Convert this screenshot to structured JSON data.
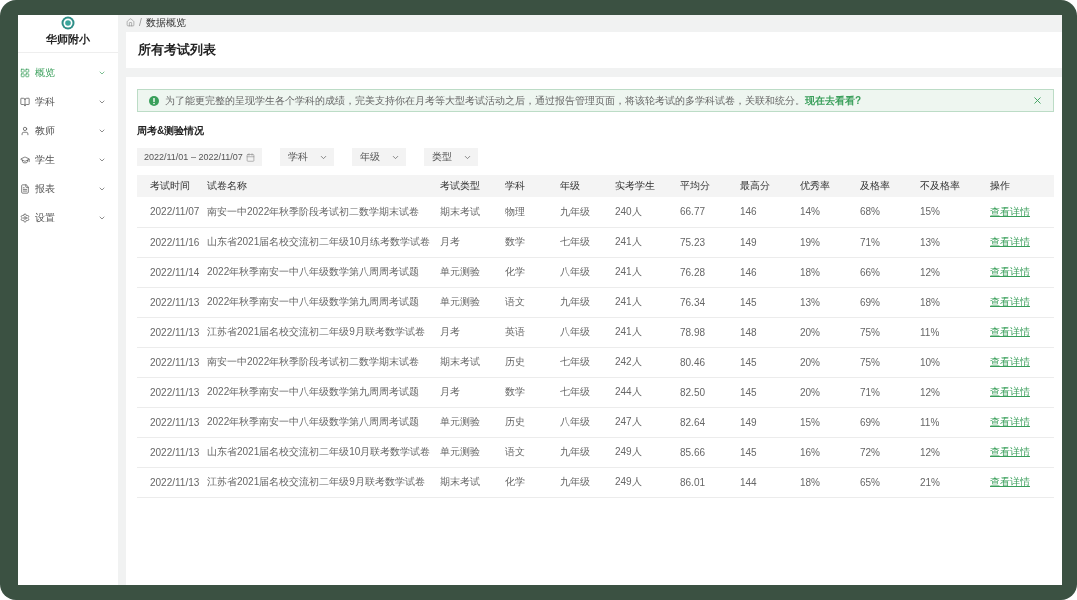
{
  "sidebar": {
    "school_name": "华师附小",
    "items": [
      {
        "label": "概览",
        "selected": true
      },
      {
        "label": "学科",
        "selected": false
      },
      {
        "label": "教师",
        "selected": false
      },
      {
        "label": "学生",
        "selected": false
      },
      {
        "label": "报表",
        "selected": false
      },
      {
        "label": "设置",
        "selected": false
      }
    ]
  },
  "breadcrumb": {
    "separator": "/",
    "label": "数据概览"
  },
  "page_title": "所有考试列表",
  "alert": {
    "message": "为了能更完整的呈现学生各个学科的成绩，完美支持你在月考等大型考试活动之后，通过报告管理页面，将该轮考试的多学科试卷，关联和统分。",
    "link": "现在去看看?"
  },
  "section_title": "周考&测验情况",
  "filters": {
    "date_range": "2022/11/01 – 2022/11/07",
    "selects": [
      {
        "label": "学科"
      },
      {
        "label": "年级"
      },
      {
        "label": "类型"
      }
    ]
  },
  "table": {
    "columns": [
      "考试时间",
      "试卷名称",
      "考试类型",
      "学科",
      "年级",
      "实考学生",
      "平均分",
      "最高分",
      "优秀率",
      "及格率",
      "不及格率",
      "操作"
    ],
    "rows": [
      {
        "cells": [
          "2022/11/07",
          "南安一中2022年秋季阶段考试初二数学期末试卷",
          "期末考试",
          "物理",
          "九年级",
          "240人",
          "66.77",
          "146",
          "14%",
          "68%",
          "15%"
        ],
        "action": "查看详情"
      },
      {
        "cells": [
          "2022/11/16",
          "山东省2021届名校交流初二年级10月练考数学试卷",
          "月考",
          "数学",
          "七年级",
          "241人",
          "75.23",
          "149",
          "19%",
          "71%",
          "13%"
        ],
        "action": "查看详情"
      },
      {
        "cells": [
          "2022/11/14",
          "2022年秋季南安一中八年级数学第八周周考试题",
          "单元测验",
          "化学",
          "八年级",
          "241人",
          "76.28",
          "146",
          "18%",
          "66%",
          "12%"
        ],
        "action": "查看详情"
      },
      {
        "cells": [
          "2022/11/13",
          "2022年秋季南安一中八年级数学第九周周考试题",
          "单元测验",
          "语文",
          "九年级",
          "241人",
          "76.34",
          "145",
          "13%",
          "69%",
          "18%"
        ],
        "action": "查看详情"
      },
      {
        "cells": [
          "2022/11/13",
          "江苏省2021届名校交流初二年级9月联考数学试卷",
          "月考",
          "英语",
          "八年级",
          "241人",
          "78.98",
          "148",
          "20%",
          "75%",
          "11%"
        ],
        "action": "查看详情"
      },
      {
        "cells": [
          "2022/11/13",
          "南安一中2022年秋季阶段考试初二数学期末试卷",
          "期末考试",
          "历史",
          "七年级",
          "242人",
          "80.46",
          "145",
          "20%",
          "75%",
          "10%"
        ],
        "action": "查看详情"
      },
      {
        "cells": [
          "2022/11/13",
          "2022年秋季南安一中八年级数学第九周周考试题",
          "月考",
          "数学",
          "七年级",
          "244人",
          "82.50",
          "145",
          "20%",
          "71%",
          "12%"
        ],
        "action": "查看详情"
      },
      {
        "cells": [
          "2022/11/13",
          "2022年秋季南安一中八年级数学第八周周考试题",
          "单元测验",
          "历史",
          "八年级",
          "247人",
          "82.64",
          "149",
          "15%",
          "69%",
          "11%"
        ],
        "action": "查看详情"
      },
      {
        "cells": [
          "2022/11/13",
          "山东省2021届名校交流初二年级10月联考数学试卷",
          "单元测验",
          "语文",
          "九年级",
          "249人",
          "85.66",
          "145",
          "16%",
          "72%",
          "12%"
        ],
        "action": "查看详情"
      },
      {
        "cells": [
          "2022/11/13",
          "江苏省2021届名校交流初二年级9月联考数学试卷",
          "期末考试",
          "化学",
          "九年级",
          "249人",
          "86.01",
          "144",
          "18%",
          "65%",
          "21%"
        ],
        "action": "查看详情"
      }
    ]
  }
}
